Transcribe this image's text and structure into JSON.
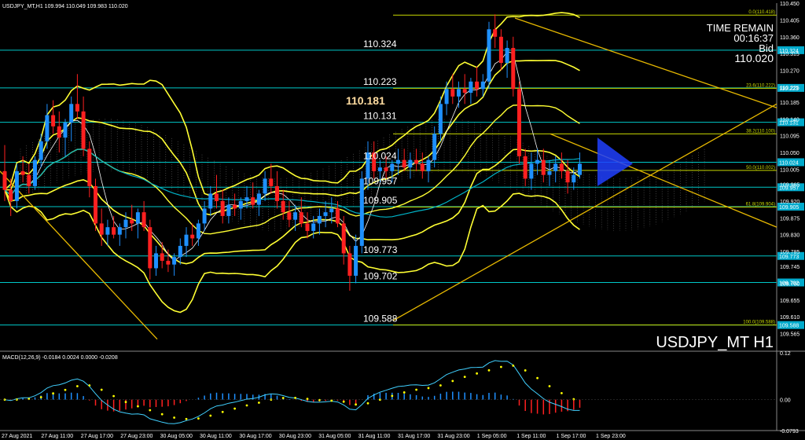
{
  "window": {
    "title_line": "USDJPY_MT,H1  109.994 110.049 109.983 110.020",
    "watermark": "USDJPY_MT H1"
  },
  "info_panel": {
    "time_remain_label": "TIME REMAIN",
    "time_remain_value": "00:16:37",
    "bid_label": "Bid",
    "bid_value": "110.020"
  },
  "colors": {
    "background": "#000000",
    "bull": "#1e90ff",
    "bear": "#ff2020",
    "bollinger": "#ffff33",
    "level_line": "#00c8c8",
    "fib": "#c8d800",
    "trendline": "#e6b800",
    "ma_white": "#ffffff",
    "ma_cyan": "#00b4c8",
    "macd_signal": "#ffff00",
    "macd_line": "#40d0ff",
    "axis_text": "#ffffff",
    "axis_tag_bg": "#00aacc"
  },
  "chart_data": [
    {
      "type": "candlestick",
      "symbol": "USDJPY_MT",
      "timeframe": "H1",
      "ylim": [
        109.52,
        110.45
      ],
      "y_ticks": [
        "110.450",
        "110.405",
        "110.360",
        "110.315",
        "110.270",
        "110.225",
        "110.185",
        "110.140",
        "110.095",
        "110.050",
        "110.005",
        "109.965",
        "109.920",
        "109.875",
        "109.830",
        "109.785",
        "109.745",
        "109.700",
        "109.655",
        "109.610",
        "109.565"
      ],
      "x_ticks": [
        "27 Aug 2021",
        "27 Aug 11:00",
        "27 Aug 17:00",
        "27 Aug 23:00",
        "30 Aug 05:00",
        "30 Aug 11:00",
        "30 Aug 17:00",
        "30 Aug 23:00",
        "31 Aug 05:00",
        "31 Aug 11:00",
        "31 Aug 17:00",
        "31 Aug 23:00",
        "1 Sep 05:00",
        "1 Sep 11:00",
        "1 Sep 17:00",
        "1 Sep 23:00"
      ],
      "price_levels": [
        {
          "label": "110.324",
          "value": 110.324
        },
        {
          "label": "110.223",
          "value": 110.223
        },
        {
          "label": "110.131",
          "value": 110.131
        },
        {
          "label": "110.024",
          "value": 110.024
        },
        {
          "label": "109.957",
          "value": 109.957
        },
        {
          "label": "109.905",
          "value": 109.905
        },
        {
          "label": "109.773",
          "value": 109.773
        },
        {
          "label": "109.702",
          "value": 109.702
        },
        {
          "label": "109.588",
          "value": 109.588
        }
      ],
      "highlight_level": {
        "label": "110.181",
        "value": 110.181
      },
      "fib_levels": [
        {
          "label": "0.0(110.418)",
          "value": 110.418
        },
        {
          "label": "23.6(110.222)",
          "value": 110.222
        },
        {
          "label": "38.2(110.100)",
          "value": 110.1
        },
        {
          "label": "50.0(110.002)",
          "value": 110.002
        },
        {
          "label": "61.8(109.904)",
          "value": 109.904
        },
        {
          "label": "100.0(109.588)",
          "value": 109.588
        }
      ],
      "candles": [
        [
          110.0,
          110.07,
          109.92,
          109.95
        ],
        [
          109.95,
          109.98,
          109.88,
          109.92
        ],
        [
          109.92,
          110.02,
          109.9,
          110.0
        ],
        [
          110.0,
          110.04,
          109.97,
          109.99
        ],
        [
          109.99,
          110.02,
          109.94,
          109.96
        ],
        [
          109.96,
          110.04,
          109.95,
          110.03
        ],
        [
          110.03,
          110.1,
          110.01,
          110.08
        ],
        [
          110.08,
          110.18,
          110.06,
          110.15
        ],
        [
          110.15,
          110.19,
          110.1,
          110.12
        ],
        [
          110.12,
          110.16,
          110.05,
          110.09
        ],
        [
          110.09,
          110.14,
          110.04,
          110.13
        ],
        [
          110.13,
          110.2,
          110.08,
          110.18
        ],
        [
          110.18,
          110.26,
          110.14,
          110.16
        ],
        [
          110.16,
          110.2,
          110.04,
          110.06
        ],
        [
          110.06,
          110.08,
          109.93,
          109.96
        ],
        [
          109.96,
          109.98,
          109.84,
          109.86
        ],
        [
          109.86,
          109.9,
          109.8,
          109.83
        ],
        [
          109.83,
          109.87,
          109.8,
          109.85
        ],
        [
          109.85,
          109.88,
          109.82,
          109.83
        ],
        [
          109.83,
          109.86,
          109.8,
          109.85
        ],
        [
          109.85,
          109.89,
          109.82,
          109.87
        ],
        [
          109.87,
          109.91,
          109.84,
          109.86
        ],
        [
          109.86,
          109.9,
          109.82,
          109.89
        ],
        [
          109.89,
          109.92,
          109.84,
          109.85
        ],
        [
          109.85,
          109.87,
          109.71,
          109.74
        ],
        [
          109.74,
          109.8,
          109.72,
          109.78
        ],
        [
          109.78,
          109.81,
          109.74,
          109.76
        ],
        [
          109.76,
          109.79,
          109.73,
          109.75
        ],
        [
          109.75,
          109.78,
          109.72,
          109.77
        ],
        [
          109.77,
          109.82,
          109.75,
          109.8
        ],
        [
          109.8,
          109.85,
          109.77,
          109.83
        ],
        [
          109.83,
          109.86,
          109.8,
          109.82
        ],
        [
          109.82,
          109.87,
          109.8,
          109.86
        ],
        [
          109.86,
          109.92,
          109.84,
          109.9
        ],
        [
          109.9,
          109.96,
          109.88,
          109.94
        ],
        [
          109.94,
          109.99,
          109.9,
          109.92
        ],
        [
          109.92,
          109.95,
          109.86,
          109.88
        ],
        [
          109.88,
          109.93,
          109.86,
          109.91
        ],
        [
          109.91,
          109.94,
          109.88,
          109.9
        ],
        [
          109.9,
          109.93,
          109.87,
          109.92
        ],
        [
          109.92,
          109.96,
          109.9,
          109.93
        ],
        [
          109.93,
          109.97,
          109.9,
          109.91
        ],
        [
          109.91,
          109.95,
          109.88,
          109.94
        ],
        [
          109.94,
          110.0,
          109.92,
          109.98
        ],
        [
          109.98,
          110.02,
          109.94,
          109.96
        ],
        [
          109.96,
          110.0,
          109.9,
          109.92
        ],
        [
          109.92,
          109.95,
          109.87,
          109.89
        ],
        [
          109.89,
          109.92,
          109.85,
          109.87
        ],
        [
          109.87,
          109.91,
          109.84,
          109.89
        ],
        [
          109.89,
          109.93,
          109.85,
          109.86
        ],
        [
          109.86,
          109.89,
          109.82,
          109.84
        ],
        [
          109.84,
          109.88,
          109.82,
          109.86
        ],
        [
          109.86,
          109.9,
          109.83,
          109.88
        ],
        [
          109.88,
          109.92,
          109.85,
          109.89
        ],
        [
          109.89,
          109.93,
          109.86,
          109.9
        ],
        [
          109.9,
          109.92,
          109.85,
          109.86
        ],
        [
          109.86,
          109.88,
          109.75,
          109.78
        ],
        [
          109.78,
          109.8,
          109.68,
          109.72
        ],
        [
          109.72,
          109.83,
          109.7,
          109.8
        ],
        [
          109.8,
          110.0,
          109.78,
          109.98
        ],
        [
          109.98,
          110.08,
          109.95,
          110.05
        ],
        [
          110.05,
          110.08,
          109.98,
          110.0
        ],
        [
          110.0,
          110.03,
          109.97,
          110.01
        ],
        [
          110.01,
          110.04,
          109.98,
          110.0
        ],
        [
          110.0,
          110.03,
          109.97,
          110.02
        ],
        [
          110.02,
          110.06,
          109.99,
          110.03
        ],
        [
          110.03,
          110.06,
          110.0,
          110.01
        ],
        [
          110.01,
          110.05,
          109.98,
          110.03
        ],
        [
          110.03,
          110.06,
          110.0,
          110.02
        ],
        [
          110.02,
          110.05,
          109.98,
          110.0
        ],
        [
          110.0,
          110.04,
          109.97,
          110.03
        ],
        [
          110.03,
          110.12,
          110.01,
          110.1
        ],
        [
          110.1,
          110.2,
          110.08,
          110.18
        ],
        [
          110.18,
          110.24,
          110.15,
          110.22
        ],
        [
          110.22,
          110.26,
          110.18,
          110.2
        ],
        [
          110.2,
          110.24,
          110.17,
          110.22
        ],
        [
          110.22,
          110.26,
          110.18,
          110.21
        ],
        [
          110.21,
          110.25,
          110.18,
          110.24
        ],
        [
          110.24,
          110.28,
          110.2,
          110.22
        ],
        [
          110.22,
          110.26,
          110.2,
          110.24
        ],
        [
          110.24,
          110.4,
          110.22,
          110.38
        ],
        [
          110.38,
          110.42,
          110.33,
          110.36
        ],
        [
          110.36,
          110.38,
          110.27,
          110.29
        ],
        [
          110.29,
          110.35,
          110.25,
          110.33
        ],
        [
          110.33,
          110.36,
          110.2,
          110.22
        ],
        [
          110.22,
          110.24,
          110.02,
          110.04
        ],
        [
          110.04,
          110.06,
          109.96,
          109.98
        ],
        [
          109.98,
          110.05,
          109.95,
          110.02
        ],
        [
          110.02,
          110.06,
          109.99,
          110.03
        ],
        [
          110.03,
          110.06,
          109.97,
          109.99
        ],
        [
          109.99,
          110.03,
          109.96,
          110.0
        ],
        [
          110.0,
          110.04,
          109.97,
          110.02
        ],
        [
          110.02,
          110.05,
          109.98,
          110.0
        ],
        [
          110.0,
          110.03,
          109.94,
          109.97
        ],
        [
          109.97,
          110.01,
          109.95,
          109.99
        ],
        [
          109.99,
          110.05,
          109.98,
          110.02
        ]
      ]
    },
    {
      "type": "macd",
      "label": "MACD(12,26,9) -0.0184 0.0024 0.0000 -0.0208",
      "ylim": [
        -0.0793,
        0.12
      ],
      "y_ticks": [
        "0.12",
        "0.00",
        "-0.0793"
      ]
    }
  ]
}
